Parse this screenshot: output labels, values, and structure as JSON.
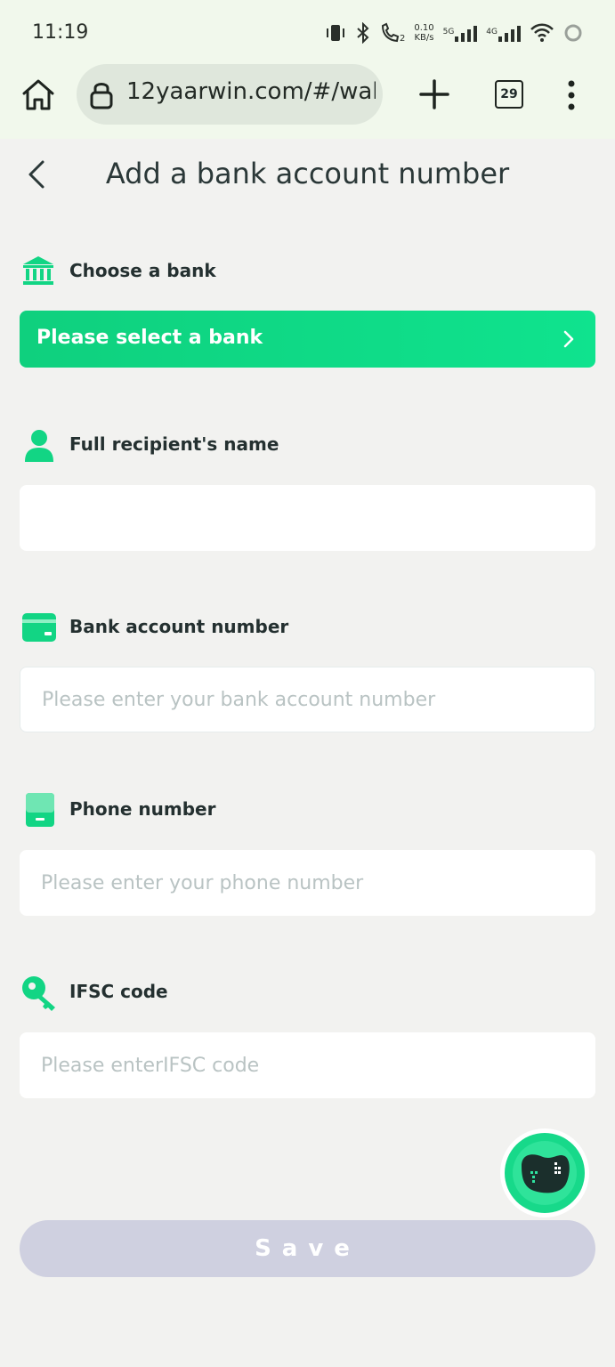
{
  "status_bar": {
    "time": "11:19",
    "net_speed_value": "0.10",
    "net_speed_unit": "KB/s",
    "sim_label_5g": "5G",
    "sim_label_4g": "4G",
    "call_sub": "2"
  },
  "browser": {
    "url": "12yaarwin.com/#/wal",
    "tab_count": "29"
  },
  "header": {
    "title": "Add a bank account number"
  },
  "form": {
    "bank": {
      "label": "Choose a bank",
      "select_text": "Please select a bank"
    },
    "recipient": {
      "label": "Full recipient's name",
      "placeholder": "",
      "value": ""
    },
    "account": {
      "label": "Bank account number",
      "placeholder": "Please enter your bank account number",
      "value": ""
    },
    "phone": {
      "label": "Phone number",
      "placeholder": "Please enter your phone number",
      "value": ""
    },
    "ifsc": {
      "label": "IFSC code",
      "placeholder": "Please enterIFSC code",
      "value": ""
    },
    "save_label": "Save"
  },
  "colors": {
    "accent": "#0fd584",
    "save_disabled": "#cfd0e0",
    "background": "#f2f2f0",
    "browser_bar": "#f1f8ec"
  }
}
